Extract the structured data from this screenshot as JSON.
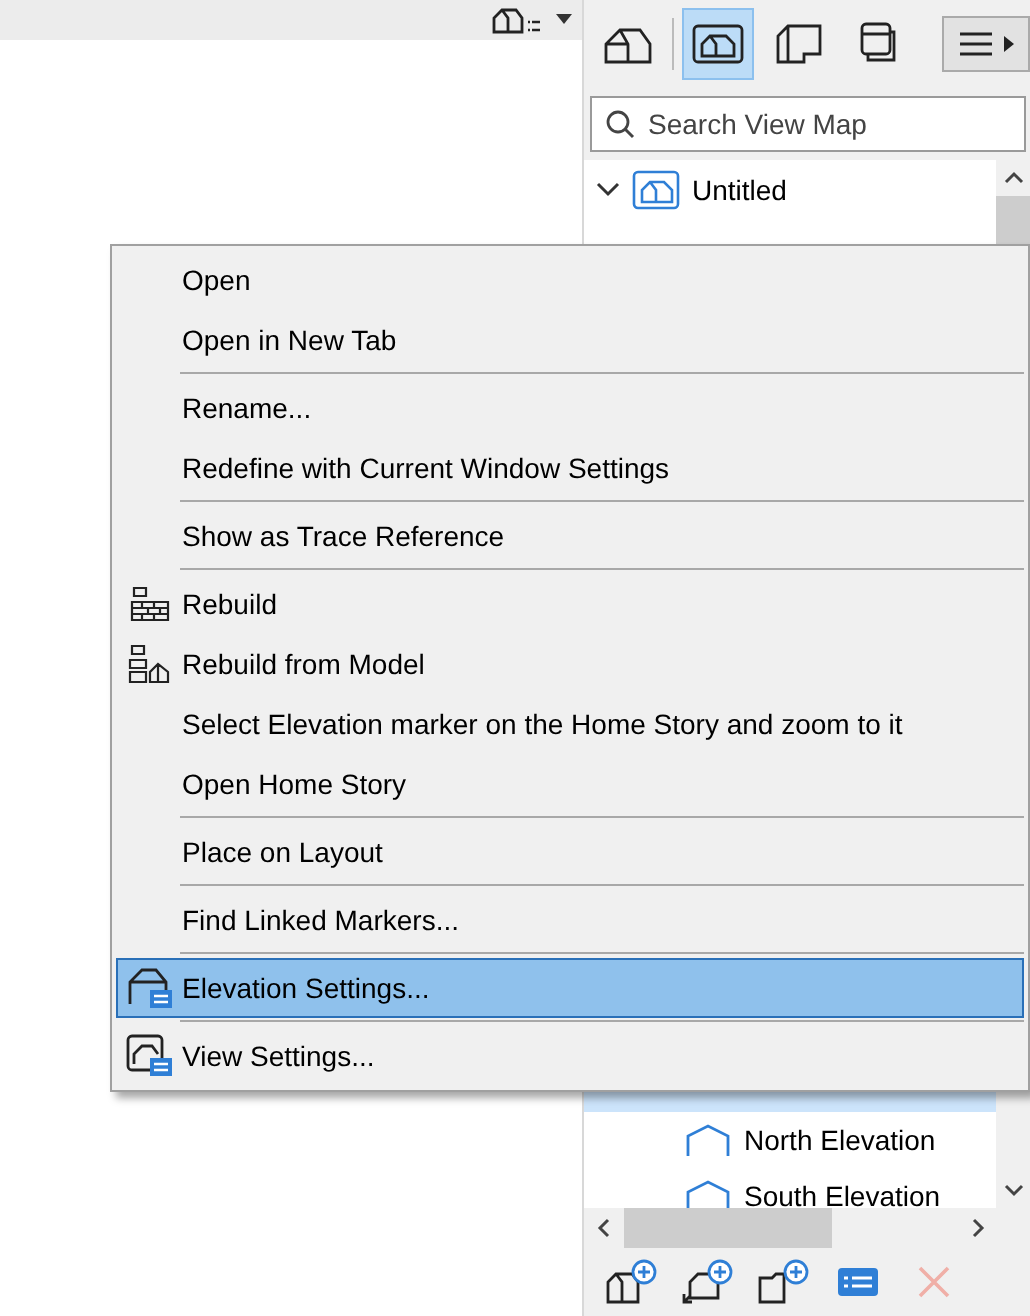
{
  "view_toolbar": [
    {
      "selected": false
    },
    {
      "selected": true
    },
    {
      "selected": false
    },
    {
      "selected": false
    }
  ],
  "search": {
    "placeholder": "Search View Map"
  },
  "tree": [
    {
      "label": "Untitled",
      "expanded": true,
      "selected": false
    }
  ],
  "tree_lower": [
    {
      "selected": true
    },
    {
      "label": "North Elevation",
      "selected": false
    },
    {
      "label": "South Elevation",
      "selected": false
    }
  ],
  "context_menu": [
    {
      "kind": "plain",
      "label": "Open",
      "selected": false
    },
    {
      "kind": "plain",
      "label": "Open in New Tab",
      "selected": false
    },
    {
      "kind": "separator"
    },
    {
      "kind": "plain",
      "label": "Rename...",
      "selected": false
    },
    {
      "kind": "plain",
      "label": "Redefine with Current Window Settings",
      "selected": false
    },
    {
      "kind": "separator"
    },
    {
      "kind": "plain",
      "label": "Show as Trace Reference",
      "selected": false
    },
    {
      "kind": "separator"
    },
    {
      "kind": "with_icon",
      "label": "Rebuild",
      "selected": false
    },
    {
      "kind": "with_icon",
      "label": "Rebuild from Model",
      "selected": false
    },
    {
      "kind": "plain",
      "label": "Select Elevation marker on the Home Story and zoom to it",
      "selected": false
    },
    {
      "kind": "plain",
      "label": "Open Home Story",
      "selected": false
    },
    {
      "kind": "separator"
    },
    {
      "kind": "plain",
      "label": "Place on Layout",
      "selected": false
    },
    {
      "kind": "separator"
    },
    {
      "kind": "plain",
      "label": "Find Linked Markers...",
      "selected": false
    },
    {
      "kind": "separator"
    },
    {
      "kind": "with_icon",
      "label": "Elevation Settings...",
      "selected": true
    },
    {
      "kind": "separator"
    },
    {
      "kind": "with_icon",
      "label": "View Settings...",
      "selected": false
    }
  ],
  "bottom_toolbar": [
    {
      "kind": "button",
      "disabled": false
    },
    {
      "kind": "button",
      "disabled": false
    },
    {
      "kind": "button",
      "disabled": false
    },
    {
      "kind": "button",
      "disabled": false
    },
    {
      "kind": "delete",
      "disabled": true
    }
  ]
}
